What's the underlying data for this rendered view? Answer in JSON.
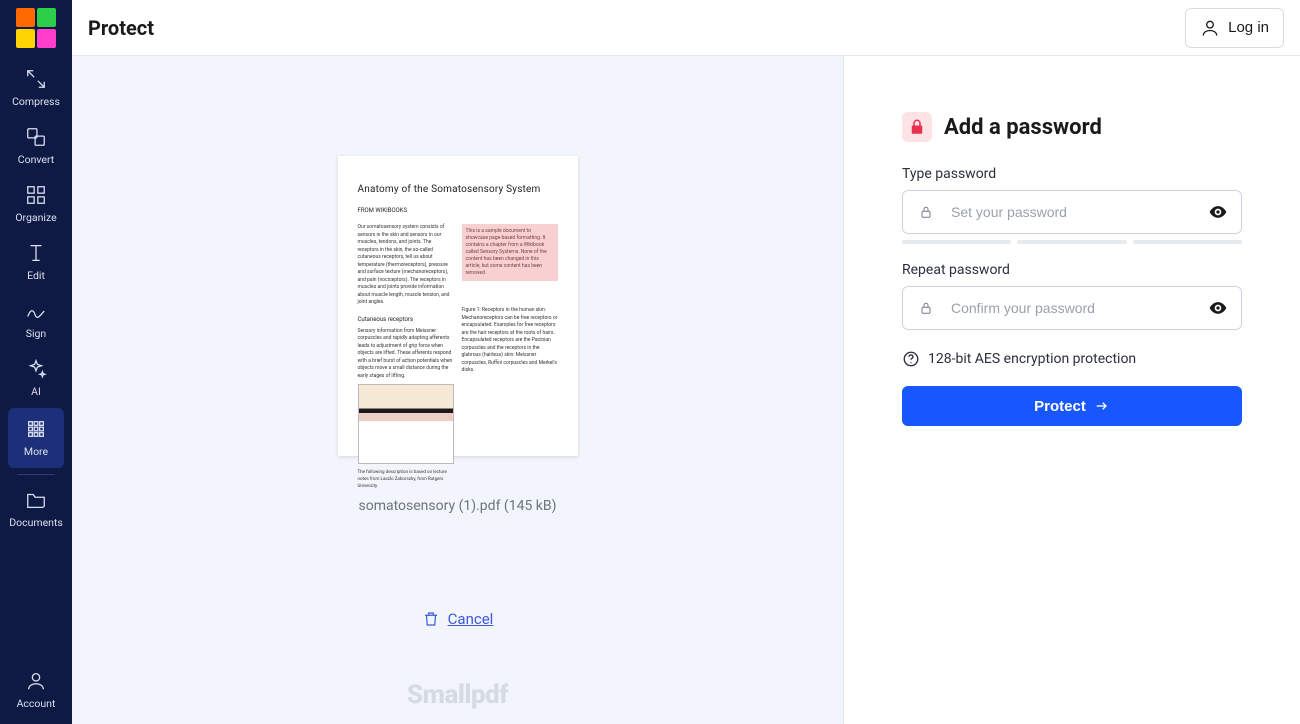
{
  "header": {
    "title": "Protect",
    "login_label": "Log in"
  },
  "sidebar": {
    "items": [
      {
        "label": "Compress"
      },
      {
        "label": "Convert"
      },
      {
        "label": "Organize"
      },
      {
        "label": "Edit"
      },
      {
        "label": "Sign"
      },
      {
        "label": "AI"
      },
      {
        "label": "More"
      },
      {
        "label": "Documents"
      }
    ],
    "account_label": "Account"
  },
  "preview": {
    "thumb_title": "Anatomy of the Somatosensory System",
    "file_name": "somatosensory (1).pdf",
    "file_size": "(145 kB)",
    "cancel_label": "Cancel",
    "watermark": "Smallpdf"
  },
  "panel": {
    "heading": "Add a password",
    "type_label": "Type password",
    "type_placeholder": "Set your password",
    "repeat_label": "Repeat password",
    "repeat_placeholder": "Confirm your password",
    "encryption_note": "128-bit AES encryption protection",
    "protect_label": "Protect"
  },
  "colors": {
    "accent": "#1857ff",
    "danger": "#e8314f",
    "sidebar_bg": "#0f1a44"
  }
}
